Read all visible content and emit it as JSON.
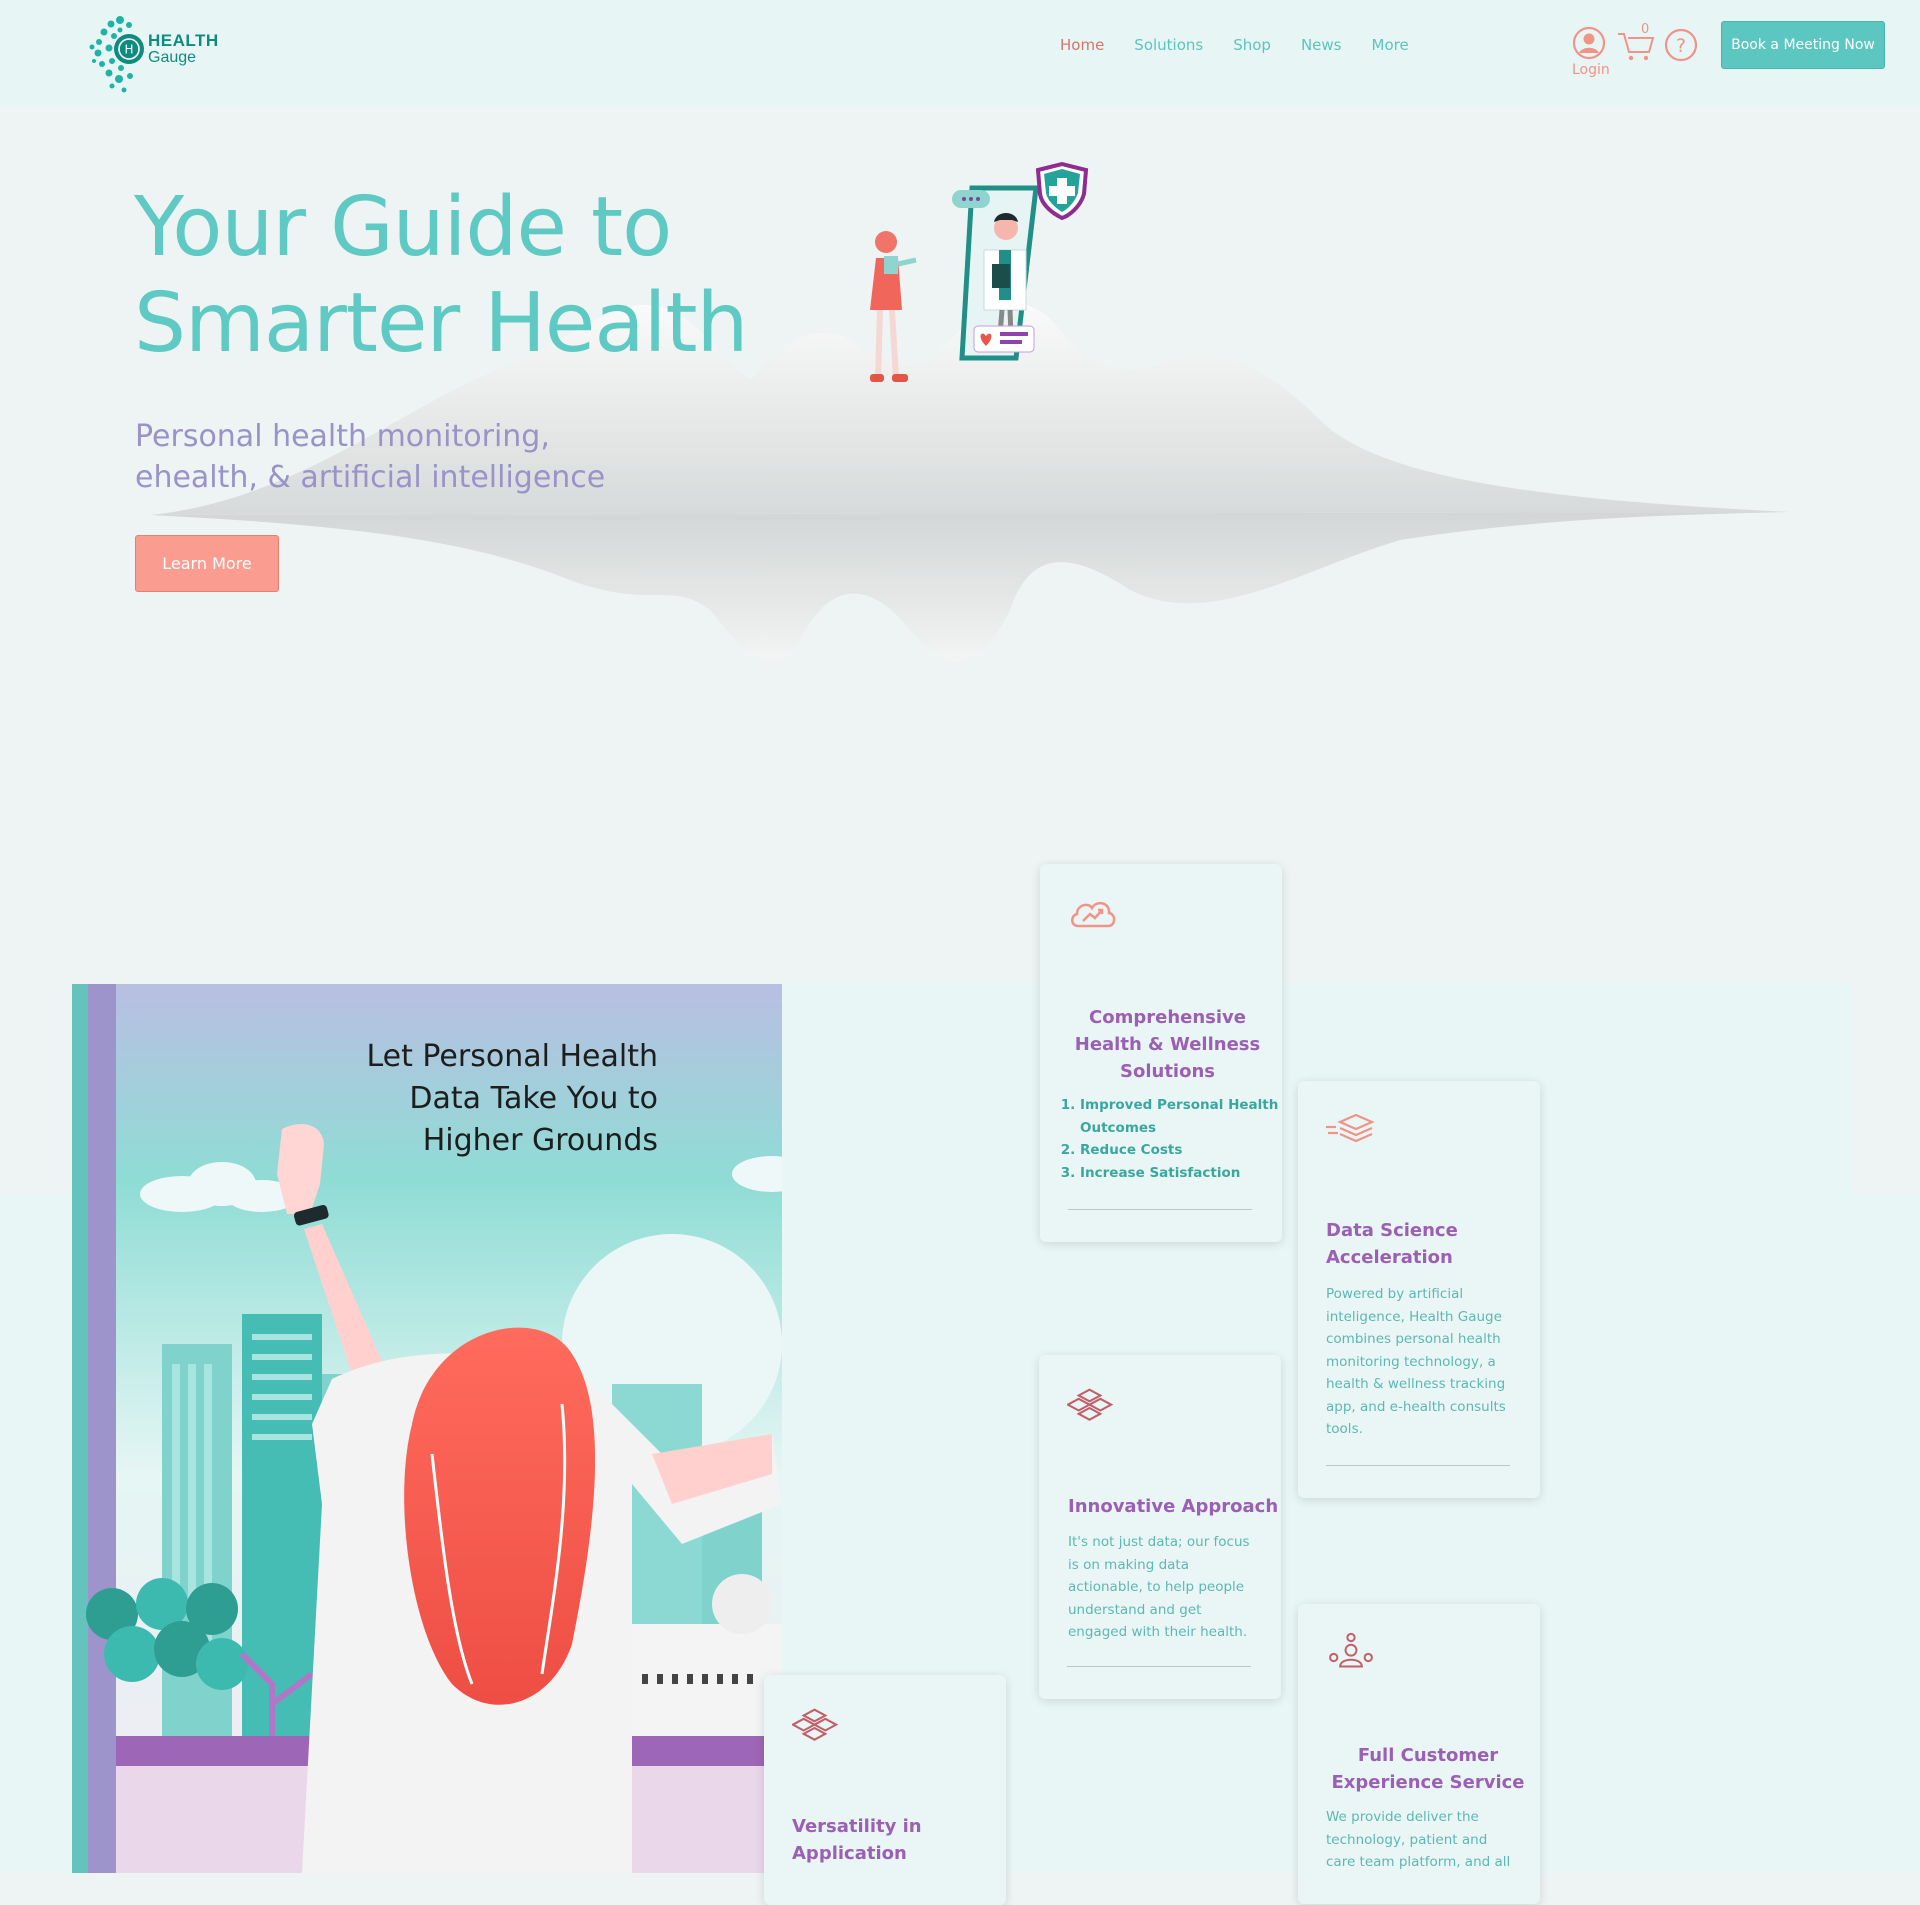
{
  "brand": {
    "line1": "HEALTH",
    "line2": "Gauge"
  },
  "nav": [
    {
      "label": "Home",
      "active": true
    },
    {
      "label": "Solutions"
    },
    {
      "label": "Shop"
    },
    {
      "label": "News"
    },
    {
      "label": "More"
    }
  ],
  "header": {
    "login_label": "Login",
    "cart_count": "0",
    "book_button": "Book a Meeting Now",
    "icons": [
      "user-icon",
      "cart-icon",
      "help-icon"
    ]
  },
  "hero": {
    "title_line1": "Your Guide to",
    "title_line2": "Smarter Health",
    "subtitle_line1": "Personal health monitoring,",
    "subtitle_line2": "ehealth, & artificial intelligence",
    "cta": "Learn More"
  },
  "art": {
    "heading_line1": "Let Personal Health",
    "heading_line2": "Data Take You to",
    "heading_line3": "Higher Grounds"
  },
  "cards": {
    "comprehensive": {
      "icon": "cloud-chart-icon",
      "title_line1": "Comprehensive",
      "title_line2": "Health & Wellness",
      "title_line3": "Solutions",
      "items": [
        "Improved Personal Health Outcomes",
        "Reduce Costs",
        "Increase Satisfaction"
      ]
    },
    "data_science": {
      "icon": "layers-speed-icon",
      "title_line1": "Data Science",
      "title_line2": "Acceleration",
      "text": "Powered by artificial inteligence, Health Gauge combines personal health monitoring technology, a health & wellness tracking app, and e-health consults tools."
    },
    "innovative": {
      "icon": "diamond-layers-icon",
      "title": "Innovative Approach",
      "text": "It's not just data; our focus is on making data actionable, to help people understand and get engaged with their health."
    },
    "versatility": {
      "icon": "diamond-layers-icon",
      "title_line1": "Versatility in",
      "title_line2": "Application"
    },
    "customer": {
      "icon": "people-network-icon",
      "title_line1": "Full Customer",
      "title_line2": "Experience Service",
      "text": "We provide deliver the technology, patient and care team platform, and all"
    }
  },
  "colors": {
    "teal": "#5fc9c3",
    "coral": "#fb9c90",
    "purple": "#9b5fb3",
    "lavender": "#9a93c8"
  }
}
